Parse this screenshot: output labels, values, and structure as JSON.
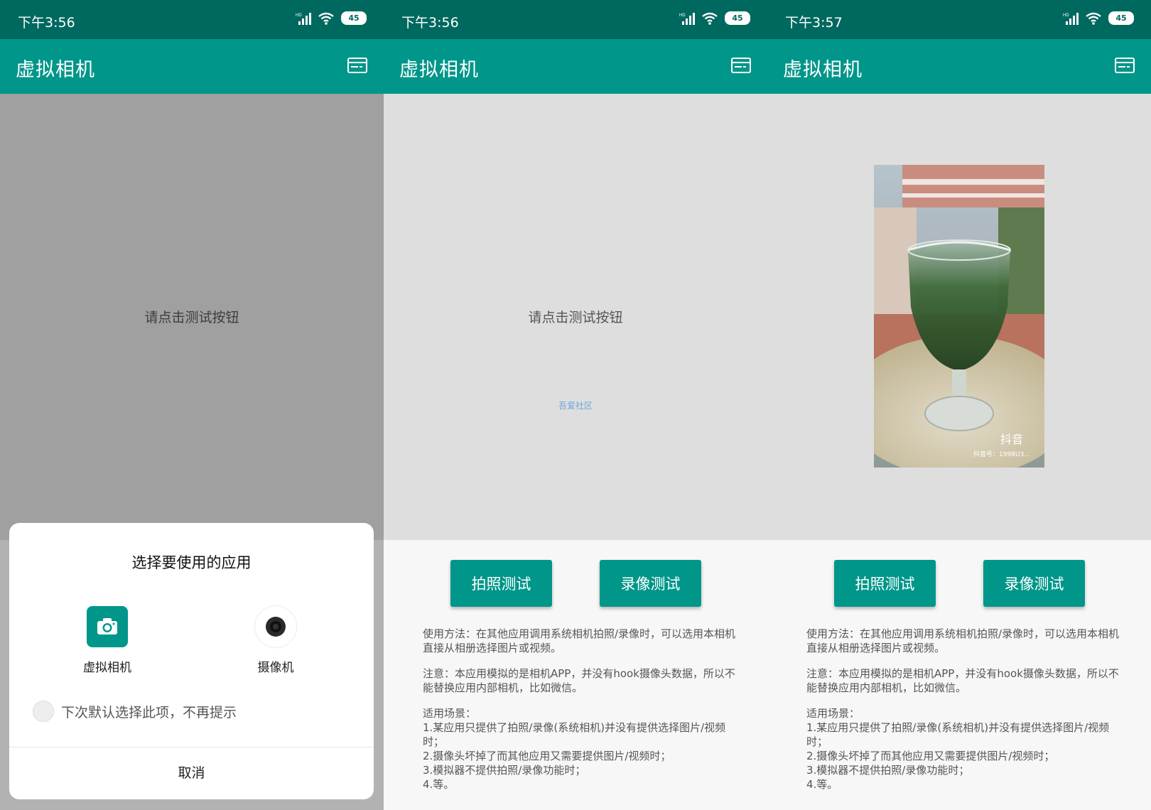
{
  "status_bar": [
    {
      "time": "下午3:56",
      "battery": "45"
    },
    {
      "time": "下午3:56",
      "battery": "45"
    },
    {
      "time": "下午3:57",
      "battery": "45"
    }
  ],
  "app_bar": {
    "title": "虚拟相机",
    "menu_icon": "card-menu-icon"
  },
  "placeholder": "请点击测试按钮",
  "watermark": "吾爱社区",
  "buttons": {
    "photo_test": "拍照测试",
    "video_test": "录像测试"
  },
  "description": {
    "usage": "使用方法：在其他应用调用系统相机拍照/录像时，可以选用本相机直接从相册选择图片或视频。",
    "note": "注意：本应用模拟的是相机APP，并没有hook摄像头数据，所以不能替换应用内部相机，比如微信。",
    "scenarios": "适用场景：\n1.某应用只提供了拍照/录像(系统相机)并没有提供选择图片/视频时；\n2.摄像头坏掉了而其他应用又需要提供图片/视频时；\n3.模拟器不提供拍照/录像功能时；\n4.等。"
  },
  "chooser": {
    "title": "选择要使用的应用",
    "apps": [
      {
        "label": "虚拟相机",
        "icon": "camera-icon"
      },
      {
        "label": "摄像机",
        "icon": "lens-icon"
      }
    ],
    "remember_label": "下次默认选择此项，不再提示",
    "cancel_label": "取消"
  },
  "preview_image": {
    "watermark_brand": "抖音",
    "watermark_id": "抖音号：1998U3..."
  },
  "colors": {
    "status_bar": "#00695f",
    "app_bar": "#00968a",
    "button": "#00968a",
    "content_bg": "#dedede"
  }
}
